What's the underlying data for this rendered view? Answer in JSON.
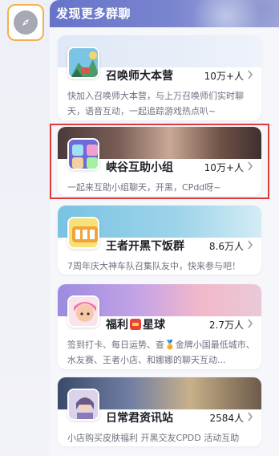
{
  "panel": {
    "title": "发现更多群聊"
  },
  "left_rail": {
    "compass_icon": "compass-icon"
  },
  "cards": [
    {
      "name": "召唤师大本营",
      "count": "10万+人",
      "desc": "快加入召唤师大本营，与上万召唤师们实时聊天，语音互动，一起追踪游戏热点叭~"
    },
    {
      "name": "峡谷互助小组",
      "count": "10万+人",
      "desc": "一起来互助小组聊天，开黑，CPdd呀~"
    },
    {
      "name": "王者开黑下饭群",
      "count": "8.6万人",
      "desc": "7周年庆大神车队召集队友中，快来参与吧！"
    },
    {
      "name_prefix": "福利",
      "name_suffix": "星球",
      "count": "2.7万人",
      "desc": "签到打卡、每日运势、查🏅金牌小国最低城市、水友赛、王者小店、和娜娜的聊天互动..."
    },
    {
      "name": "日常君资讯站",
      "count": "2584人",
      "desc": "小店购买皮肤福利 开黑交友CPDD 活动互助"
    }
  ],
  "colors": {
    "header": "#6673c8",
    "highlight": "#e03a3a",
    "compass_border": "#f4b04a"
  }
}
